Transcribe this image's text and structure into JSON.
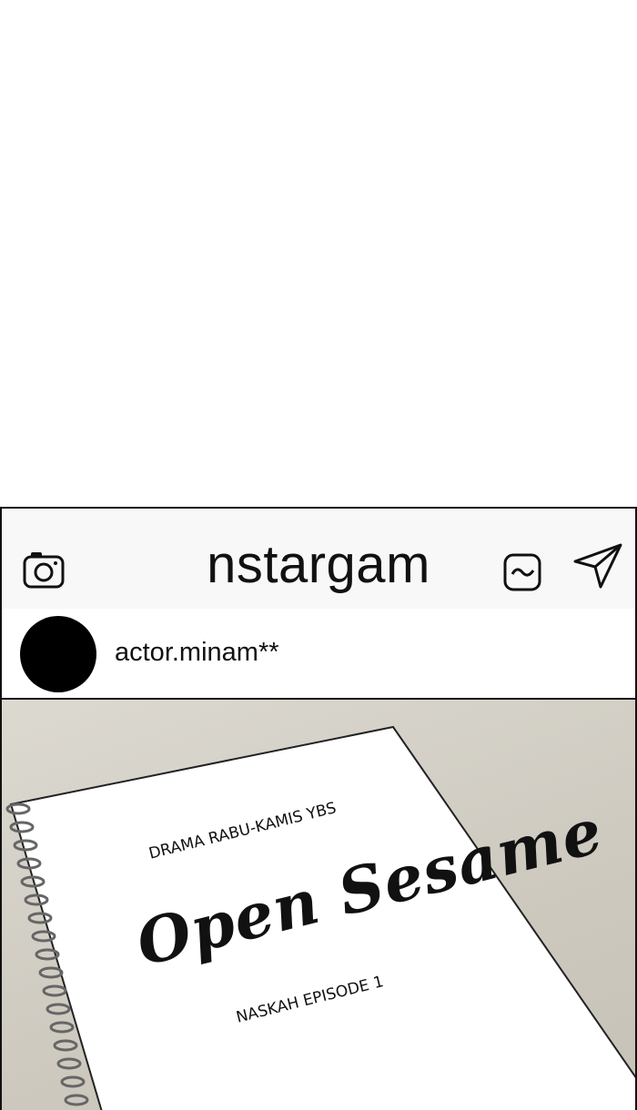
{
  "app": {
    "title": "nstargam"
  },
  "header": {
    "icons": [
      "camera-icon",
      "activity-icon",
      "send-icon"
    ]
  },
  "post": {
    "username": "actor.minam**",
    "script": {
      "line1": "DRAMA RABU-KAMIS YBS",
      "title": "Open Sesame",
      "line3": "NASKAH EPISODE 1"
    }
  },
  "colors": {
    "frame_border": "#111111",
    "topbar_bg": "#f8f8f8",
    "avatar": "#000000",
    "photo_bg": "#cdc9bf"
  }
}
